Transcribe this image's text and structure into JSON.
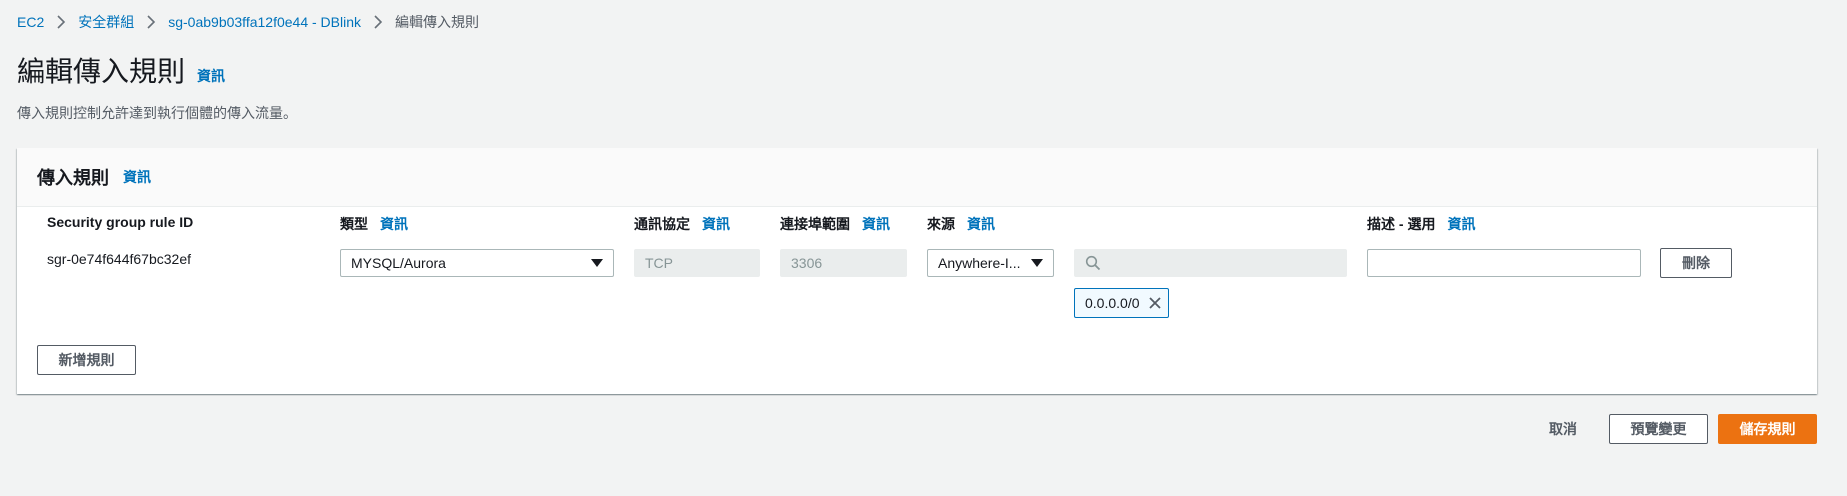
{
  "breadcrumb": {
    "items": [
      "EC2",
      "安全群組",
      "sg-0ab9b03ffa12f0e44 - DBlink"
    ],
    "current": "編輯傳入規則"
  },
  "page": {
    "title": "編輯傳入規則",
    "info": "資訊",
    "description": "傳入規則控制允許達到執行個體的傳入流量。"
  },
  "panel": {
    "title": "傳入規則",
    "info": "資訊",
    "columns": {
      "rule_id": "Security group rule ID",
      "type": "類型",
      "protocol": "通訊協定",
      "port_range": "連接埠範圍",
      "source": "來源",
      "description": "描述 - 選用",
      "info": "資訊"
    },
    "rule": {
      "id": "sgr-0e74f644f67bc32ef",
      "type": "MYSQL/Aurora",
      "protocol": "TCP",
      "port_range": "3306",
      "source": "Anywhere-I...",
      "source_search": "",
      "cidr_token": "0.0.0.0/0",
      "description": "",
      "delete_label": "刪除"
    },
    "add_rule_label": "新增規則"
  },
  "footer": {
    "cancel": "取消",
    "preview": "預覽變更",
    "save": "儲存規則"
  },
  "colors": {
    "link": "#0073bb",
    "primary": "#ec7211",
    "background": "#f2f3f3"
  }
}
